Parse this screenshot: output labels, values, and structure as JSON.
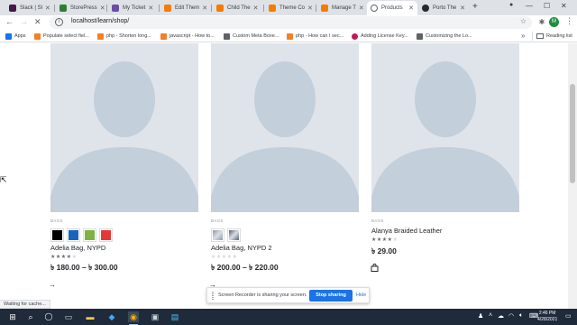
{
  "browser": {
    "tabs": [
      {
        "label": "Slack | Sl",
        "color": "#4a154b"
      },
      {
        "label": "StorePress",
        "color": "#2e7d32"
      },
      {
        "label": "My Ticket",
        "color": "#6a4ca3"
      },
      {
        "label": "Edit Them",
        "color": "#f57c00"
      },
      {
        "label": "Child The",
        "color": "#f57c00"
      },
      {
        "label": "Theme Co",
        "color": "#f57c00"
      },
      {
        "label": "Manage T",
        "color": "#f57c00"
      },
      {
        "label": "Products",
        "color": "#5f6368"
      },
      {
        "label": "Porto The",
        "color": "#24292e"
      }
    ],
    "active_tab_index": 7,
    "url": "localhost/learn/shop/",
    "profile_initial": "M",
    "bookmarks": [
      {
        "label": "Apps",
        "color": "#1a73e8"
      },
      {
        "label": "Populate select fiel...",
        "color": "#f48024"
      },
      {
        "label": "php - Shorten long...",
        "color": "#f48024"
      },
      {
        "label": "javascript - How to...",
        "color": "#f48024"
      },
      {
        "label": "Custom Meta Boxe...",
        "color": "#5f6368"
      },
      {
        "label": "php - How can I sec...",
        "color": "#f48024"
      },
      {
        "label": "Adding License Key...",
        "color": "#c2185b"
      },
      {
        "label": "Customizing the Lo...",
        "color": "#5f6368"
      }
    ],
    "reading_list": "Reading list",
    "status_text": "Waiting for cache..."
  },
  "products": [
    {
      "category": "BAGS",
      "title": "Adelia Bag, NYPD",
      "price": "৳ 180.00 – ৳ 300.00",
      "rating": 4,
      "swatches": [
        "#000000",
        "#1565c0",
        "#7cb342",
        "#e53935"
      ],
      "image_swatches": false,
      "action_icon": "arrow-right-icon"
    },
    {
      "category": "BAGS",
      "title": "Adelia Bag, NYPD 2",
      "price": "৳ 200.00 – ৳ 220.00",
      "rating": 0,
      "swatches": [
        "#8d99a6",
        "#566474"
      ],
      "image_swatches": true,
      "action_icon": "arrow-right-icon"
    },
    {
      "category": "BAGS",
      "title": "Alanya Braided Leather",
      "price": "৳ 29.00",
      "rating": 4,
      "swatches": [],
      "image_swatches": false,
      "action_icon": "shopping-bag-icon"
    }
  ],
  "recorder": {
    "message": "Screen Recorder is sharing your screen.",
    "stop_label": "Stop sharing",
    "hide_label": "Hide"
  },
  "taskbar": {
    "time": "2:46 PM",
    "date": "4/28/2021"
  },
  "colors": {
    "placeholder_bg": "#dfe4ea",
    "silhouette": "#c3cfdb",
    "star_filled": "#6a6a6a",
    "star_empty": "#d8d8d8",
    "recorder_button": "#1a73e8",
    "taskbar": "#1f2a3a"
  }
}
